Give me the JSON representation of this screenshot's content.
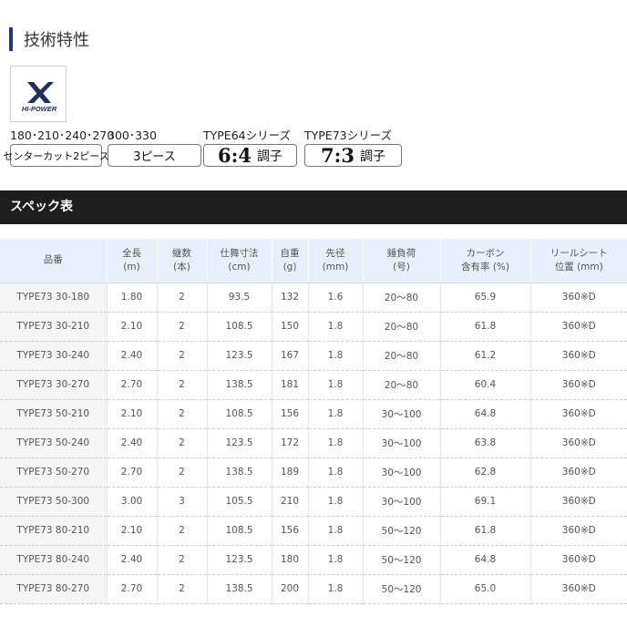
{
  "tech": {
    "heading": "技術特性"
  },
  "logo": {
    "mark": "X",
    "caption": "HI-POWER"
  },
  "features": [
    {
      "caption": "180･210･240･270",
      "label": "センターカット2ピース"
    },
    {
      "caption": "300･330",
      "label": "3ピース"
    },
    {
      "caption": "TYPE64シリーズ",
      "big": "6:4",
      "suffix": "調子"
    },
    {
      "caption": "TYPE73シリーズ",
      "big": "7:3",
      "suffix": "調子"
    }
  ],
  "spec": {
    "heading": "スペック表",
    "headers": [
      {
        "line1": "品番",
        "line2": ""
      },
      {
        "line1": "全長",
        "line2": "(m)"
      },
      {
        "line1": "継数",
        "line2": "(本)"
      },
      {
        "line1": "仕舞寸法",
        "line2": "(cm)"
      },
      {
        "line1": "自重",
        "line2": "(g)"
      },
      {
        "line1": "先径",
        "line2": "(mm)"
      },
      {
        "line1": "錘負荷",
        "line2": "(号)"
      },
      {
        "line1": "カーボン",
        "line2": "含有率 (%)"
      },
      {
        "line1": "リールシート",
        "line2": "位置 (mm)"
      }
    ],
    "rows": [
      [
        "TYPE73 30-180",
        "1.80",
        "2",
        "93.5",
        "132",
        "1.6",
        "20～80",
        "65.9",
        "360※D"
      ],
      [
        "TYPE73 30-210",
        "2.10",
        "2",
        "108.5",
        "150",
        "1.8",
        "20～80",
        "61.8",
        "360※D"
      ],
      [
        "TYPE73 30-240",
        "2.40",
        "2",
        "123.5",
        "167",
        "1.8",
        "20～80",
        "61.2",
        "360※D"
      ],
      [
        "TYPE73 30-270",
        "2.70",
        "2",
        "138.5",
        "181",
        "1.8",
        "20～80",
        "60.4",
        "360※D"
      ],
      [
        "TYPE73 50-210",
        "2.10",
        "2",
        "108.5",
        "156",
        "1.8",
        "30～100",
        "64.8",
        "360※D"
      ],
      [
        "TYPE73 50-240",
        "2.40",
        "2",
        "123.5",
        "172",
        "1.8",
        "30～100",
        "63.8",
        "360※D"
      ],
      [
        "TYPE73 50-270",
        "2.70",
        "2",
        "138.5",
        "189",
        "1.8",
        "30～100",
        "62.8",
        "360※D"
      ],
      [
        "TYPE73 50-300",
        "3.00",
        "3",
        "105.5",
        "210",
        "1.8",
        "30～100",
        "69.1",
        "360※D"
      ],
      [
        "TYPE73 80-210",
        "2.10",
        "2",
        "108.5",
        "156",
        "1.8",
        "50～120",
        "61.8",
        "360※D"
      ],
      [
        "TYPE73 80-240",
        "2.40",
        "2",
        "123.5",
        "180",
        "1.8",
        "50～120",
        "64.8",
        "360※D"
      ],
      [
        "TYPE73 80-270",
        "2.70",
        "2",
        "138.5",
        "200",
        "1.8",
        "50～120",
        "65.0",
        "360※D"
      ]
    ]
  }
}
